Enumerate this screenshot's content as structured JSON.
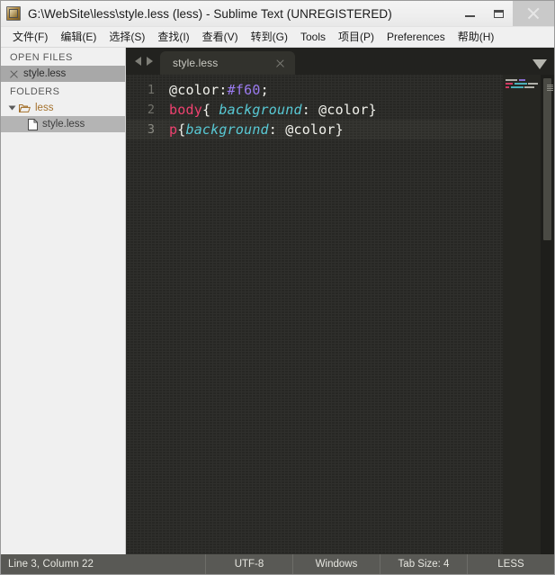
{
  "window": {
    "title": "G:\\WebSite\\less\\style.less (less) - Sublime Text (UNREGISTERED)",
    "icon": "sublime-text-icon",
    "minimize_label": "–",
    "maximize_label": "□",
    "close_label": "×"
  },
  "menubar": {
    "items": [
      {
        "label": "文件(F)"
      },
      {
        "label": "编辑(E)"
      },
      {
        "label": "选择(S)"
      },
      {
        "label": "查找(I)"
      },
      {
        "label": "查看(V)"
      },
      {
        "label": "转到(G)"
      },
      {
        "label": "Tools"
      },
      {
        "label": "项目(P)"
      },
      {
        "label": "Preferences"
      },
      {
        "label": "帮助(H)"
      }
    ]
  },
  "sidebar": {
    "open_files": {
      "heading": "OPEN FILES",
      "items": [
        {
          "label": "style.less",
          "icon": "close-icon",
          "selected": true
        }
      ]
    },
    "folders": {
      "heading": "FOLDERS",
      "items": [
        {
          "label": "less",
          "icon": "folder-open-icon",
          "expanded": true,
          "type": "folder"
        },
        {
          "label": "style.less",
          "icon": "file-icon",
          "selected": true,
          "type": "file"
        }
      ]
    }
  },
  "tabbar": {
    "prev_label": "◀",
    "next_label": "▶",
    "menu_label": "▼",
    "tabs": [
      {
        "label": "style.less",
        "active": true,
        "close_label": "×"
      }
    ]
  },
  "editor": {
    "lines": [
      {
        "number": "1",
        "active": false,
        "tokens": [
          {
            "text": "@color",
            "type": "plain"
          },
          {
            "text": ":",
            "type": "punct"
          },
          {
            "text": "#f60",
            "type": "num"
          },
          {
            "text": ";",
            "type": "punct"
          }
        ]
      },
      {
        "number": "2",
        "active": false,
        "tokens": [
          {
            "text": "body",
            "type": "tag"
          },
          {
            "text": "{ ",
            "type": "punct"
          },
          {
            "text": "background",
            "type": "prop"
          },
          {
            "text": ": @color}",
            "type": "plain"
          }
        ]
      },
      {
        "number": "3",
        "active": true,
        "tokens": [
          {
            "text": "p",
            "type": "tag"
          },
          {
            "text": "{",
            "type": "punct"
          },
          {
            "text": "background",
            "type": "prop"
          },
          {
            "text": ": @color}",
            "type": "plain"
          }
        ]
      }
    ]
  },
  "statusbar": {
    "position": "Line 3, Column 22",
    "encoding": "UTF-8",
    "line_endings": "Windows",
    "tab_size": "Tab Size: 4",
    "syntax": "LESS"
  },
  "colors": {
    "accent_tag": "#ef3e6d",
    "accent_prop": "#55c8d4",
    "accent_num": "#9a79f0",
    "editor_bg": "#272724",
    "sidebar_bg": "#f0f0f0",
    "statusbar_bg": "#595955",
    "folder_label": "#a4712c"
  }
}
